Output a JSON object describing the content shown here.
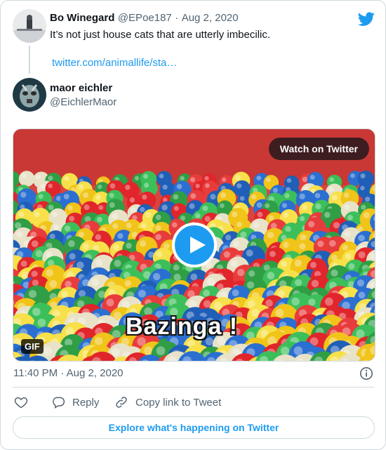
{
  "tweet": {
    "author_name": "Bo Winegard",
    "author_handle": "@EPoe187",
    "separator": "·",
    "date": "Aug 2, 2020",
    "text": "It’s not just house cats that are utterly imbecilic.",
    "link": "twitter.com/animallife/sta…"
  },
  "quoted": {
    "author_name": "maor eichler",
    "author_handle": "@EichlerMaor"
  },
  "media": {
    "watch_label": "Watch on Twitter",
    "badge": "GIF",
    "caption": "Bazinga !"
  },
  "meta": {
    "time": "11:40 PM",
    "separator": "·",
    "date": "Aug 2, 2020"
  },
  "actions": {
    "reply_label": "Reply",
    "copy_label": "Copy link to Tweet"
  },
  "explore_label": "Explore what's happening on Twitter",
  "colors": {
    "accent": "#1d9bf0",
    "text": "#0f1419",
    "muted": "#536471",
    "border": "#cfd9de"
  },
  "icons": [
    "twitter-bird-icon",
    "play-icon",
    "info-icon",
    "heart-icon",
    "reply-icon",
    "link-icon"
  ]
}
